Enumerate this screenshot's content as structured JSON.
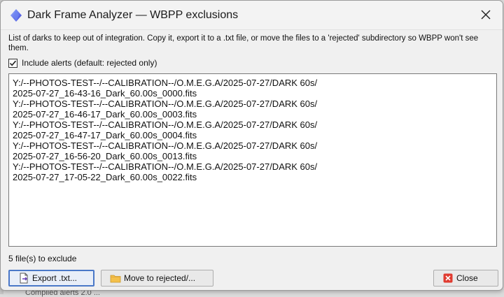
{
  "window": {
    "title": "Dark Frame Analyzer — WBPP exclusions"
  },
  "description": "List of darks to keep out of integration. Copy it, export it to a .txt file, or move the files to a 'rejected' subdirectory so WBPP won't see them.",
  "include_alerts": {
    "label": "Include alerts (default: rejected only)",
    "checked": true
  },
  "files": [
    {
      "dir": "Y:/--PHOTOS-TEST--/--CALIBRATION--/O.M.E.G.A/2025-07-27/DARK 60s/",
      "name": "2025-07-27_16-43-16_Dark_60.00s_0000.fits"
    },
    {
      "dir": "Y:/--PHOTOS-TEST--/--CALIBRATION--/O.M.E.G.A/2025-07-27/DARK 60s/",
      "name": "2025-07-27_16-46-17_Dark_60.00s_0003.fits"
    },
    {
      "dir": "Y:/--PHOTOS-TEST--/--CALIBRATION--/O.M.E.G.A/2025-07-27/DARK 60s/",
      "name": "2025-07-27_16-47-17_Dark_60.00s_0004.fits"
    },
    {
      "dir": "Y:/--PHOTOS-TEST--/--CALIBRATION--/O.M.E.G.A/2025-07-27/DARK 60s/",
      "name": "2025-07-27_16-56-20_Dark_60.00s_0013.fits"
    },
    {
      "dir": "Y:/--PHOTOS-TEST--/--CALIBRATION--/O.M.E.G.A/2025-07-27/DARK 60s/",
      "name": "2025-07-27_17-05-22_Dark_60.00s_0022.fits"
    }
  ],
  "status": {
    "count_text": "5 file(s) to exclude"
  },
  "buttons": {
    "export": {
      "label": "Export .txt...",
      "icon": "export-document-icon"
    },
    "move": {
      "label": "Move to rejected/...",
      "icon": "folder-icon"
    },
    "close": {
      "label": "Close",
      "icon": "close-red-icon"
    }
  },
  "background": {
    "partial_text": "Compiled alerts 2.0 ..."
  },
  "colors": {
    "accent": "#4a78c8",
    "close_red": "#e03c31",
    "folder": "#f4c04a"
  }
}
